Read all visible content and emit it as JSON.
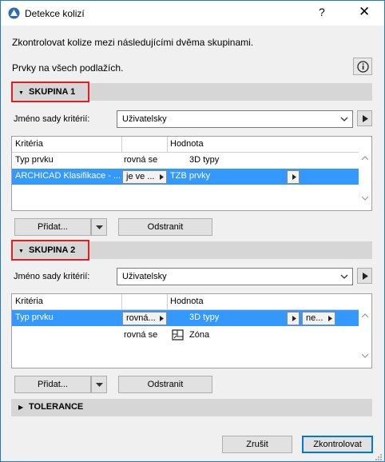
{
  "window": {
    "title": "Detekce kolizí",
    "help": "?",
    "close": "✕"
  },
  "intro": {
    "line1": "Zkontrolovat kolize mezi následujícími dvěma skupinami.",
    "line2": "Prvky na všech podlažích."
  },
  "group1": {
    "label": "SKUPINA 1",
    "criteria_set_label": "Jméno sady kritérií:",
    "criteria_set_value": "Uživatelsky",
    "columns": [
      "Kritéria",
      "",
      "Hodnota"
    ],
    "rows": [
      {
        "criterion": "Typ prvku",
        "operator": "rovná se",
        "value": "3D typy"
      },
      {
        "criterion": "ARCHICAD Klasifikace - ...",
        "operator": "je ve ...",
        "value": "TZB prvky"
      }
    ],
    "add_label": "Přidat...",
    "remove_label": "Odstranit"
  },
  "group2": {
    "label": "SKUPINA 2",
    "criteria_set_label": "Jméno sady kritérií:",
    "criteria_set_value": "Uživatelsky",
    "columns": [
      "Kritéria",
      "",
      "Hodnota"
    ],
    "rows": [
      {
        "criterion": "Typ prvku",
        "operator": "rovná...",
        "value": "3D typy",
        "extra": "ne..."
      },
      {
        "criterion": "",
        "operator": "rovná se",
        "value": "Zóna"
      }
    ],
    "add_label": "Přidat...",
    "remove_label": "Odstranit"
  },
  "tolerance": {
    "label": "TOLERANCE"
  },
  "footer": {
    "cancel_label": "Zrušit",
    "check_label": "Zkontrolovat"
  },
  "colors": {
    "accent": "#0078d7",
    "selection": "#3399ff",
    "highlight_border": "#e02020"
  }
}
